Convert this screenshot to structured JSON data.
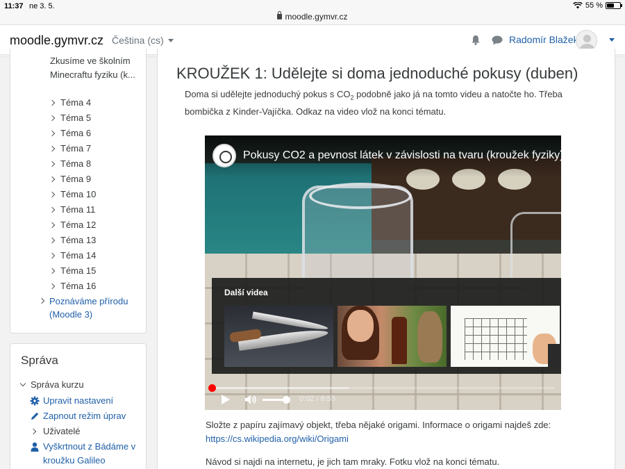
{
  "statusbar": {
    "time": "11:37",
    "date": "ne 3. 5.",
    "url": "moodle.gymvr.cz",
    "battery": "55 %",
    "battery_level": 0.55
  },
  "navbar": {
    "brand": "moodle.gymvr.cz",
    "language": "Čeština (cs)",
    "username": "Radomír Blažek",
    "icons": [
      "bell-icon",
      "chat-icon"
    ]
  },
  "nav_block": {
    "current_topic_text": "Zkusíme ve školním Minecraftu fyziku (k...",
    "topics": [
      "Téma 4",
      "Téma 5",
      "Téma 6",
      "Téma 7",
      "Téma 8",
      "Téma 9",
      "Téma 10",
      "Téma 11",
      "Téma 12",
      "Téma 13",
      "Téma 14",
      "Téma 15",
      "Téma 16"
    ],
    "other_course": "Poznáváme přírodu (Moodle 3)"
  },
  "admin_block": {
    "title": "Správa",
    "course_admin": "Správa kurzu",
    "items": [
      {
        "label": "Upravit nastavení",
        "icon": "gear-icon",
        "link": true
      },
      {
        "label": "Zapnout režim úprav",
        "icon": "pencil-icon",
        "link": true
      },
      {
        "label": "Uživatelé",
        "icon": "chevron-right-icon",
        "link": false
      },
      {
        "label": "Vyškrtnout z Bádáme v kroužku Galileo",
        "icon": "user-icon",
        "link": true
      }
    ]
  },
  "main": {
    "title": "KROUŽEK 1: Udělejte si doma jednoduché pokusy (duben)",
    "intro_before_sub": "Doma si udělejte jednoduchý pokus s CO",
    "intro_sub": "2",
    "intro_after_sub": " podobně jako já na tomto videu a natočte ho. Třeba bombička z Kinder-Vajíčka. Odkaz na video vlož na konci tématu.",
    "para2_text": "Složte z papíru zajímavý objekt, třeba nějaké origami. Informace o origami najdeš zde: ",
    "para2_link": "https://cs.wikipedia.org/wiki/Origami",
    "para3": "Návod si najdi na internetu, je jich tam mraky. Fotku vlož na konci tématu."
  },
  "video": {
    "title": "Pokusy CO2 a pevnost látek v závislosti na tvaru (kroužek fyziky)",
    "related_label": "Další videa",
    "timecode": "0:02 / 6:55",
    "played_fraction": 0.005,
    "loaded_fraction": 0.4,
    "volume_fraction": 0.85
  }
}
